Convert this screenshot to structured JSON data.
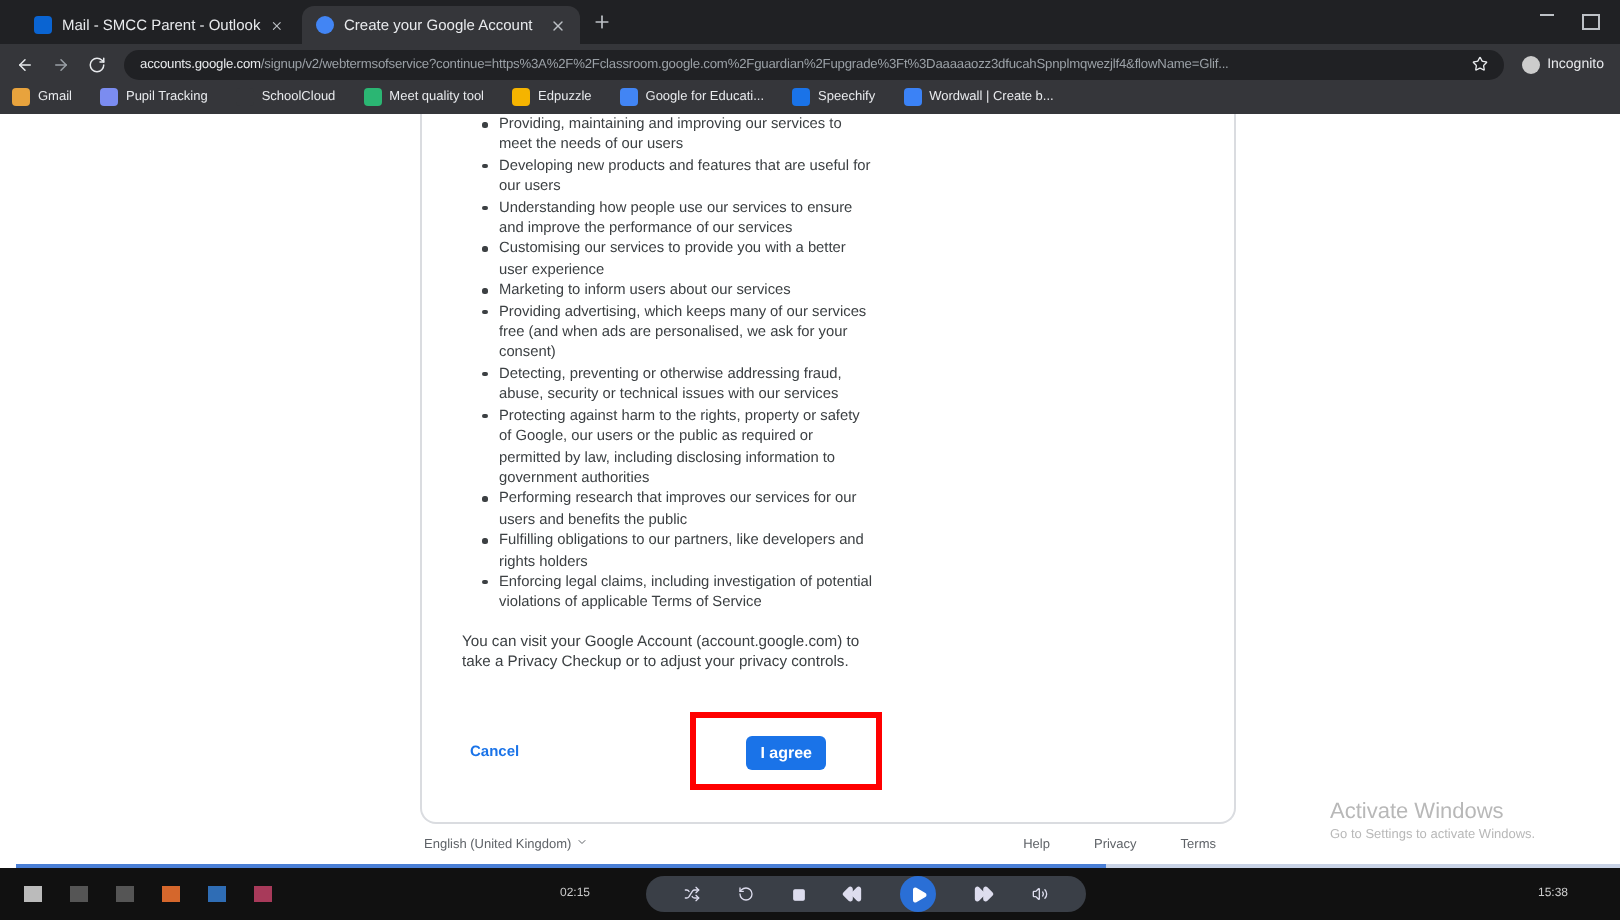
{
  "tabs": [
    {
      "title": "Mail - SMCC Parent - Outlook",
      "selected": false
    },
    {
      "title": "Create your Google Account",
      "selected": true
    }
  ],
  "address": {
    "domain": "accounts.google.com",
    "path": "/signup/v2/webtermsofservice?continue=https%3A%2F%2Fclassroom.google.com%2Fguardian%2Fupgrade%3Ft%3Daaaaaozz3dfucahSpnplmqwezjlf4&flowName=Glif..."
  },
  "profile": "Incognito",
  "bookmarks": [
    "Gmail",
    "Pupil Tracking",
    "SchoolCloud",
    "Meet quality tool",
    "Edpuzzle",
    "Google for Educati...",
    "Speechify",
    "Wordwall | Create b..."
  ],
  "terms": {
    "bullets": [
      "Providing, maintaining and improving our services to meet the needs of our users",
      "Developing new products and features that are useful for our users",
      "Understanding how people use our services to ensure and improve the performance of our services",
      "Customising our services to provide you with a better user experience",
      "Marketing to inform users about our services",
      "Providing advertising, which keeps many of our services free (and when ads are personalised, we ask for your consent)",
      "Detecting, preventing or otherwise addressing fraud, abuse, security or technical issues with our services",
      "Protecting against harm to the rights, property or safety of Google, our users or the public as required or permitted by law, including disclosing information to government authorities",
      "Performing research that improves our services for our users and benefits the public",
      "Fulfilling obligations to our partners, like developers and rights holders",
      "Enforcing legal claims, including investigation of potential violations of applicable Terms of Service"
    ],
    "paragraph": "You can visit your Google Account (account.google.com) to take a Privacy Checkup or to adjust your privacy controls.",
    "cancel": "Cancel",
    "agree": "I agree"
  },
  "footer": {
    "language": "English (United Kingdom)",
    "links": [
      "Help",
      "Privacy",
      "Terms"
    ]
  },
  "watermark_notice": {
    "title": "Activate Windows",
    "subtitle": "Go to Settings to activate Windows."
  },
  "player": {
    "time": "02:15",
    "level": 0.68
  },
  "taskbar": {
    "clock": "15:38"
  }
}
